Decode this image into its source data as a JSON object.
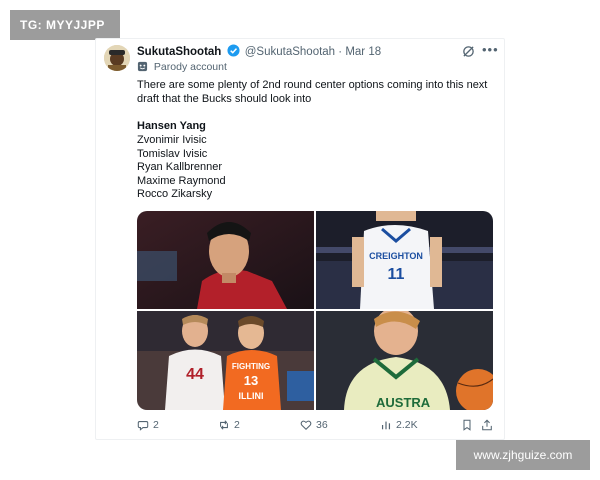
{
  "watermarks": {
    "top": "TG: MYYJJPP",
    "bottom": "www.zjhguize.com"
  },
  "tweet": {
    "display_name": "SukutaShootah",
    "handle": "@SukutaShootah",
    "separator": "·",
    "date": "Mar 18",
    "label": "Parody account",
    "text": "There are some plenty of 2nd round center options coming into this next draft that the Bucks should look into",
    "players_heading": "Hansen Yang",
    "players": [
      "Zvonimir Ivisic",
      "Tomislav Ivisic",
      "Ryan Kallbrenner",
      "Maxime Raymond",
      "Rocco Zikarsky"
    ],
    "media": {
      "photo2_jersey_text": "CREIGHTON",
      "photo2_jersey_number": "11",
      "photo3_left_number": "44",
      "photo3_right_text_1": "FIGHTING",
      "photo3_right_number": "13",
      "photo3_right_text_2": "ILLINI",
      "photo4_jersey_text": "AUSTRA"
    },
    "actions": {
      "replies": "2",
      "reposts": "2",
      "likes": "36",
      "views": "2.2K"
    }
  },
  "icons": [
    "verified-icon",
    "grok-icon",
    "more-icon",
    "parody-mask-icon",
    "reply-icon",
    "repost-icon",
    "like-icon",
    "views-icon",
    "bookmark-icon",
    "share-icon"
  ],
  "colors": {
    "verified": "#1d9bf0",
    "text": "#0f1419",
    "muted": "#536471",
    "watermark": "#9c9c9c"
  }
}
